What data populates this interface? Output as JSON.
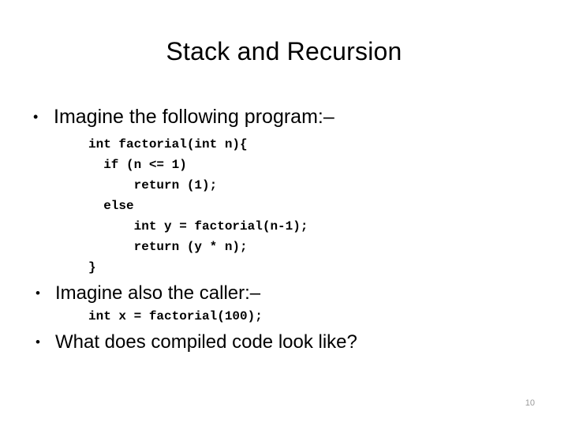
{
  "slide": {
    "title": "Stack and Recursion",
    "page_number": "10",
    "bullets": [
      {
        "marker": "•",
        "text": "Imagine the following program:–"
      },
      {
        "marker": "•",
        "text": "Imagine also the caller:–"
      },
      {
        "marker": "•",
        "text": "What does compiled code look like?"
      }
    ],
    "code_blocks": [
      {
        "name": "factorial-definition",
        "lines": [
          "int factorial(int n){",
          "  if (n <= 1)",
          "      return (1);",
          "  else",
          "      int y = factorial(n-1);",
          "      return (y * n);",
          "}"
        ],
        "text": "int factorial(int n){\n  if (n <= 1)\n      return (1);\n  else\n      int y = factorial(n-1);\n      return (y * n);\n}"
      },
      {
        "name": "caller-statement",
        "lines": [
          "int x = factorial(100);"
        ],
        "text": "int x = factorial(100);"
      }
    ],
    "colors": {
      "background": "#ffffff",
      "text": "#000000",
      "page_number": "#9a9a9a"
    }
  }
}
